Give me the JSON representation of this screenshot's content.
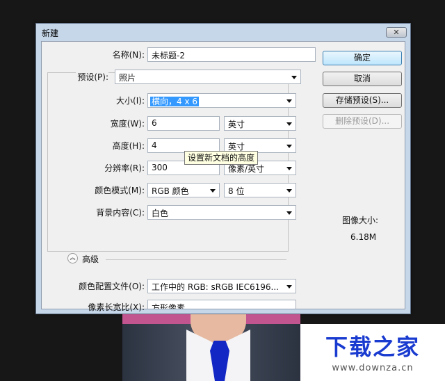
{
  "dialog": {
    "title": "新建"
  },
  "form": {
    "name_label": "名称(N):",
    "name_value": "未标题-2",
    "preset_label": "预设(P):",
    "preset_value": "照片",
    "size_label": "大小(I):",
    "size_value": "横向，4 x 6",
    "width_label": "宽度(W):",
    "width_value": "6",
    "width_unit": "英寸",
    "height_label": "高度(H):",
    "height_value": "4",
    "height_unit": "英寸",
    "resolution_label": "分辨率(R):",
    "resolution_value": "300",
    "resolution_unit": "像素/英寸",
    "color_mode_label": "颜色模式(M):",
    "color_mode_value": "RGB 颜色",
    "bit_depth_value": "8 位",
    "background_label": "背景内容(C):",
    "background_value": "白色",
    "advanced_label": "高级",
    "color_profile_label": "颜色配置文件(O):",
    "color_profile_value": "工作中的 RGB: sRGB IEC6196...",
    "pixel_aspect_label": "像素长宽比(X):",
    "pixel_aspect_value": "方形像素"
  },
  "tooltip": "设置新文档的高度",
  "buttons": {
    "ok": "确定",
    "cancel": "取消",
    "save_preset": "存储预设(S)...",
    "delete_preset": "删除预设(D)..."
  },
  "image_size": {
    "label": "图像大小:",
    "value": "6.18M"
  },
  "watermark": {
    "brand": "下载之家",
    "url": "www.downza.cn"
  },
  "colors": {
    "accent": "#3399ff",
    "brand": "#1a3bd0"
  }
}
